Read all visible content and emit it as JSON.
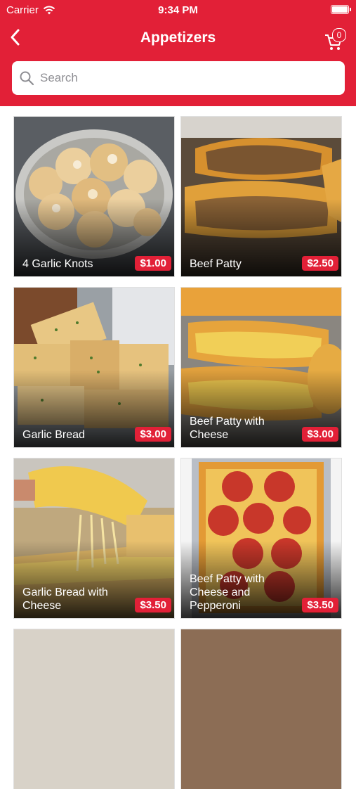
{
  "status": {
    "carrier": "Carrier",
    "time": "9:34 PM"
  },
  "nav": {
    "title": "Appetizers",
    "cart_count": "0"
  },
  "search": {
    "placeholder": "Search"
  },
  "colors": {
    "brand": "#e22037"
  },
  "items": [
    {
      "name": "4 Garlic Knots",
      "price": "$1.00"
    },
    {
      "name": "Beef Patty",
      "price": "$2.50"
    },
    {
      "name": "Garlic Bread",
      "price": "$3.00"
    },
    {
      "name": "Beef Patty with Cheese",
      "price": "$3.00"
    },
    {
      "name": "Garlic Bread with Cheese",
      "price": "$3.50"
    },
    {
      "name": "Beef Patty with Cheese and Pepperoni",
      "price": "$3.50"
    }
  ]
}
